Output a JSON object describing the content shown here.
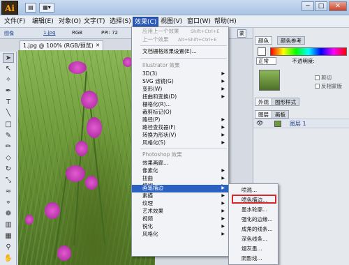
{
  "titlebar": {
    "logo": "Ai",
    "win_min": "─",
    "win_max": "□",
    "win_close": "✕"
  },
  "menubar": {
    "items": [
      "文件(F)",
      "编辑(E)",
      "对象(O)",
      "文字(T)",
      "选择(S)",
      "效果(C)",
      "视图(V)",
      "窗口(W)",
      "帮助(H)"
    ],
    "active": "效果(C)"
  },
  "control_bar": {
    "image_label": "图像",
    "file_link": "1.jpg",
    "color_mode": "RGB",
    "ppi": "PPI: 72",
    "right_btn": "蒙"
  },
  "document": {
    "tab_title": "1.jpg @ 100% (RGB/预览)",
    "tab_close": "✕"
  },
  "effects_menu": {
    "apply_last": "应用上一个效果",
    "apply_last_sc": "Shift+Ctrl+E",
    "last": "上一个效果",
    "last_sc": "Alt+Shift+Ctrl+E",
    "doc_raster": "文档栅格效果设置(E)...",
    "illustrator_header": "Illustrator 效果",
    "illustrator_items": [
      "3D(3)",
      "SVG 滤镜(G)",
      "变形(W)",
      "扭曲和变换(D)",
      "栅格化(R)...",
      "裁剪标记(O)",
      "路径(P)",
      "路径查找器(F)",
      "转换为形状(V)",
      "风格化(S)"
    ],
    "photoshop_header": "Photoshop 效果",
    "photoshop_items": [
      "效果画廊...",
      "像素化",
      "扭曲",
      "模糊",
      "画笔描边",
      "素描",
      "纹理",
      "艺术效果",
      "视频",
      "锐化",
      "风格化"
    ],
    "active": "画笔描边"
  },
  "brush_submenu": {
    "items": [
      "喷溅...",
      "喷色描边...",
      "墨水轮廓...",
      "强化的边缘...",
      "成角的线条...",
      "深色线条...",
      "烟灰墨...",
      "阴影线..."
    ],
    "highlighted": "喷色描边..."
  },
  "panels": {
    "color_tabs": [
      "颜色",
      "颜色参考"
    ],
    "transparency": {
      "mode": "正常",
      "opacity_label": "不透明度:"
    },
    "checks": [
      "剪切",
      "反相蒙版"
    ],
    "appearance_tabs": [
      "外观",
      "图形样式"
    ],
    "layers_tabs": [
      "图层",
      "画板"
    ],
    "layer_name": "图层 1"
  },
  "colors": {
    "menu_active": "#2b62c2",
    "highlight_box": "#d9262a",
    "flower": "#c43bb8"
  }
}
